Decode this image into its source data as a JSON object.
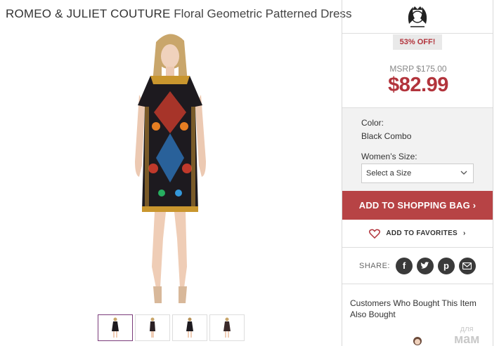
{
  "product": {
    "brand": "ROMEO & JULIET COUTURE",
    "name": "Floral Geometric Patterned Dress"
  },
  "thumbnails": [
    {
      "alt": "Front view",
      "active": true
    },
    {
      "alt": "Side view",
      "active": false
    },
    {
      "alt": "Back view",
      "active": false
    },
    {
      "alt": "Detail view",
      "active": false
    }
  ],
  "pricing": {
    "badge": "53% OFF!",
    "msrp": "MSRP $175.00",
    "price": "$82.99"
  },
  "options": {
    "color_label": "Color:",
    "color_value": "Black Combo",
    "size_label": "Women’s Size:",
    "size_placeholder": "Select a Size"
  },
  "actions": {
    "add_to_bag": "ADD TO SHOPPING BAG",
    "add_to_favorites": "ADD TO FAVORITES"
  },
  "share": {
    "label": "SHARE:",
    "networks": [
      "facebook-icon",
      "twitter-icon",
      "pinterest-icon",
      "email-icon"
    ]
  },
  "recommendations": {
    "title": "Customers Who Bought This Item Also Bought"
  },
  "watermark": {
    "small": "для",
    "big": "мам"
  },
  "colors": {
    "accent": "#b2343c",
    "button": "#b74345",
    "thumb_active": "#7a3b7a"
  }
}
